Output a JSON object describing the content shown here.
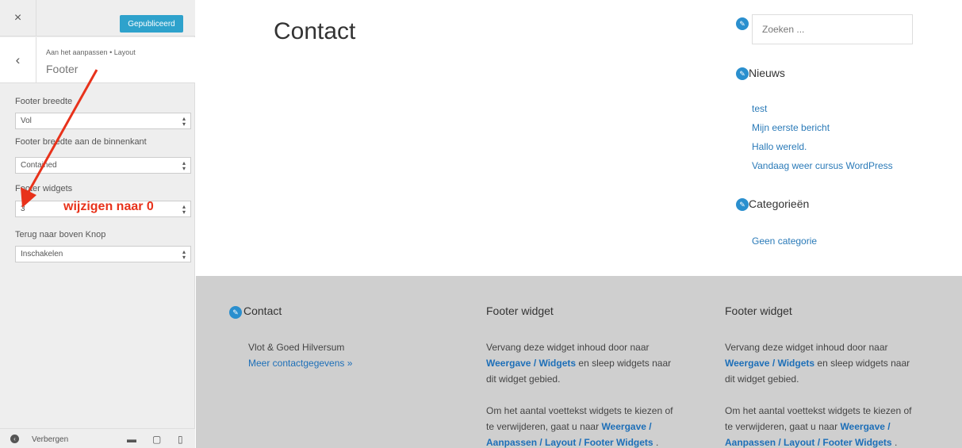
{
  "sidebar": {
    "close_symbol": "×",
    "publish_label": "Gepubliceerd",
    "back_symbol": "‹",
    "breadcrumb": "Aan het aanpassen • Layout",
    "section_title": "Footer",
    "fields": [
      {
        "label": "Footer breedte",
        "value": "Vol"
      },
      {
        "label": "Footer breedte aan de binnenkant",
        "value": "Contained"
      },
      {
        "label": "Footer widgets",
        "value": "3"
      },
      {
        "label": "Terug naar boven Knop",
        "value": "Inschakelen"
      }
    ],
    "annotation": "wijzigen naar 0",
    "annotation_color": "#e8321b",
    "hide_label": "Verbergen",
    "device_icons": [
      "desktop-icon",
      "tablet-icon",
      "mobile-icon"
    ]
  },
  "preview": {
    "page_title": "Contact",
    "search_placeholder": "Zoeken ...",
    "news": {
      "title": "Nieuws",
      "links": [
        "test",
        "Mijn eerste bericht",
        "Hallo wereld.",
        "Vandaag weer cursus WordPress"
      ]
    },
    "categories": {
      "title": "Categorieën",
      "links": [
        "Geen categorie"
      ]
    },
    "footer": {
      "contact": {
        "title": "Contact",
        "line1": "Vlot & Goed Hilversum",
        "link": "Meer contactgegevens »"
      },
      "widget_title": "Footer widget",
      "p1_a": "Vervang deze widget inhoud door naar",
      "p1_b": "Weergave / Widgets",
      "p1_c": "en sleep widgets naar",
      "p1_d": "dit widget gebied.",
      "p2_a": "Om het aantal voettekst widgets te kiezen of",
      "p2_b": "te verwijderen, gaat u naar",
      "p2_c": "Weergave /",
      "p2_d": "Aanpassen / Layout / Footer Widgets",
      "p2_e": "."
    },
    "accent_color": "#2a8fce",
    "footer_bg": "#cfcfcf"
  }
}
